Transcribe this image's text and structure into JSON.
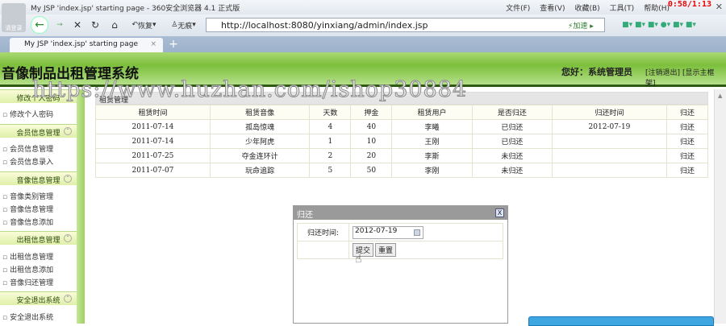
{
  "browser": {
    "window_title": "My JSP 'index.jsp' starting page - 360安全浏览器 4.1 正式版",
    "menu": [
      "文件(F)",
      "查看(V)",
      "收藏(B)",
      "工具(T)",
      "帮助(H)"
    ],
    "timer": "0:58/1:13",
    "avatar_label": "请登录",
    "restore": "恢复",
    "no_trace": "无痕",
    "url": "http://localhost:8080/yinxiang/admin/index.jsp",
    "speed": "加速",
    "tab_title": "My JSP 'index.jsp' starting page"
  },
  "header": {
    "system_name": "音像制品出租管理系统",
    "greeting": "您好：系统管理员",
    "logout": "[注销退出]",
    "show_frame": "[显示主框架]"
  },
  "watermark": "https://www.huzhan.com/ishop30884",
  "sidebar": [
    {
      "title": "修改个人密码",
      "items": [
        "修改个人密码"
      ]
    },
    {
      "title": "会员信息管理",
      "items": [
        "会员信息管理",
        "会员信息录入"
      ]
    },
    {
      "title": "音像信息管理",
      "items": [
        "音像类别管理",
        "音像信息管理",
        "音像信息添加"
      ]
    },
    {
      "title": "出租信息管理",
      "items": [
        "出租信息管理",
        "出租信息添加",
        "音像归还管理"
      ]
    },
    {
      "title": "安全退出系统",
      "items": [
        "安全退出系统"
      ]
    }
  ],
  "main": {
    "caption": "租赁管理",
    "columns": [
      "租赁时间",
      "租赁音像",
      "天数",
      "押金",
      "租赁用户",
      "是否归还",
      "归还时间",
      "归还"
    ],
    "rows": [
      [
        "2011-07-14",
        "孤岛惊魂",
        "4",
        "40",
        "李曦",
        "已归还",
        "2012-07-19",
        "归还"
      ],
      [
        "2011-07-14",
        "少年阿虎",
        "1",
        "10",
        "王刚",
        "已归还",
        "",
        "归还"
      ],
      [
        "2011-07-25",
        "夺金连环计",
        "2",
        "20",
        "李斯",
        "未归还",
        "",
        "归还"
      ],
      [
        "2011-07-07",
        "玩命追踪",
        "5",
        "50",
        "李刚",
        "未归还",
        "",
        "归还"
      ]
    ]
  },
  "dialog": {
    "title": "归还",
    "close": "X",
    "label": "归还时间:",
    "date_value": "2012-07-19",
    "submit": "提交",
    "reset": "重置"
  }
}
